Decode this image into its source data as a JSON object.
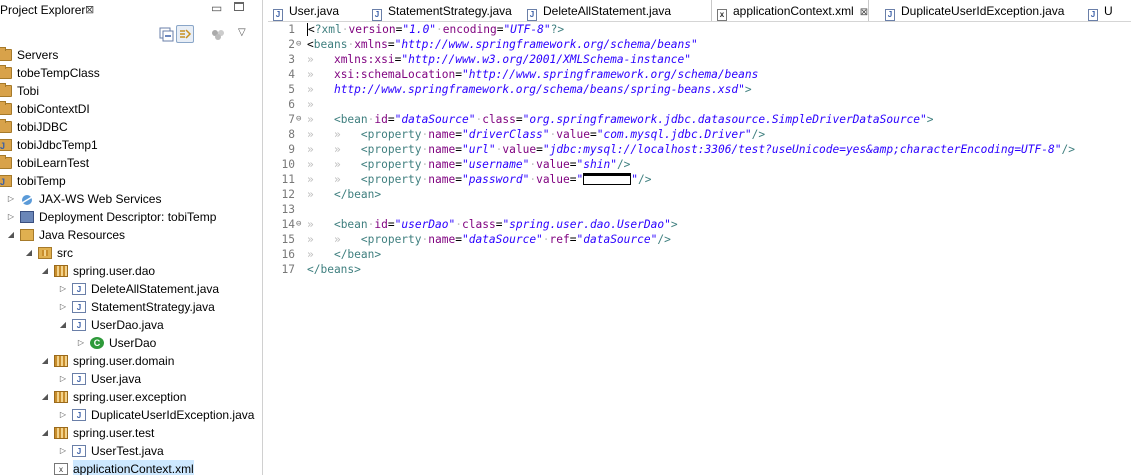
{
  "explorer": {
    "title": "Project Explorer",
    "close_glyph": "⊠",
    "min_glyph": "▭",
    "menu_glyph": "▽",
    "tree": [
      {
        "label": "Servers",
        "icon": "folder-icon",
        "depth": 0,
        "twisty": ""
      },
      {
        "label": "tobeTempClass",
        "icon": "folder-icon",
        "depth": 0,
        "twisty": ""
      },
      {
        "label": "Tobi",
        "icon": "folder-icon",
        "depth": 0,
        "twisty": ""
      },
      {
        "label": "tobiContextDI",
        "icon": "folder-icon",
        "depth": 0,
        "twisty": ""
      },
      {
        "label": "tobiJDBC",
        "icon": "folder-icon",
        "depth": 0,
        "twisty": ""
      },
      {
        "label": "tobiJdbcTemp1",
        "icon": "java-project-icon",
        "depth": 0,
        "twisty": ""
      },
      {
        "label": "tobiLearnTest",
        "icon": "folder-icon",
        "depth": 0,
        "twisty": ""
      },
      {
        "label": "tobiTemp",
        "icon": "java-project-icon",
        "depth": 0,
        "twisty": ""
      },
      {
        "label": "JAX-WS Web Services",
        "icon": "web-services-icon",
        "depth": 1,
        "twisty": "▷"
      },
      {
        "label": "Deployment Descriptor: tobiTemp",
        "icon": "deployment-descriptor-icon",
        "depth": 1,
        "twisty": "▷"
      },
      {
        "label": "Java Resources",
        "icon": "java-resources-icon",
        "depth": 1,
        "twisty": "◢"
      },
      {
        "label": "src",
        "icon": "source-folder-icon",
        "depth": 2,
        "twisty": "◢"
      },
      {
        "label": "spring.user.dao",
        "icon": "package-icon",
        "depth": 3,
        "twisty": "◢"
      },
      {
        "label": "DeleteAllStatement.java",
        "icon": "java-file-icon",
        "depth": 4,
        "twisty": "▷"
      },
      {
        "label": "StatementStrategy.java",
        "icon": "java-file-icon",
        "depth": 4,
        "twisty": "▷"
      },
      {
        "label": "UserDao.java",
        "icon": "java-file-icon",
        "depth": 4,
        "twisty": "◢"
      },
      {
        "label": "UserDao",
        "icon": "class-icon",
        "depth": 5,
        "twisty": "▷"
      },
      {
        "label": "spring.user.domain",
        "icon": "package-icon",
        "depth": 3,
        "twisty": "◢"
      },
      {
        "label": "User.java",
        "icon": "java-file-icon",
        "depth": 4,
        "twisty": "▷"
      },
      {
        "label": "spring.user.exception",
        "icon": "package-icon",
        "depth": 3,
        "twisty": "◢"
      },
      {
        "label": "DuplicateUserIdException.java",
        "icon": "java-file-icon",
        "depth": 4,
        "twisty": "▷"
      },
      {
        "label": "spring.user.test",
        "icon": "package-icon",
        "depth": 3,
        "twisty": "◢"
      },
      {
        "label": "UserTest.java",
        "icon": "java-file-icon",
        "depth": 4,
        "twisty": "▷"
      },
      {
        "label": "applicationContext.xml",
        "icon": "xml-file-icon",
        "depth": 3,
        "twisty": "",
        "selected": true
      }
    ]
  },
  "editor": {
    "tabs": [
      {
        "label": "User.java",
        "icon": "java-file-icon",
        "active": false
      },
      {
        "label": "StatementStrategy.java",
        "icon": "java-file-icon",
        "active": false
      },
      {
        "label": "DeleteAllStatement.java",
        "icon": "java-file-icon",
        "active": false
      },
      {
        "label": "applicationContext.xml",
        "icon": "xml-file-icon",
        "active": true,
        "close": "⊠"
      },
      {
        "label": "DuplicateUserIdException.java",
        "icon": "java-file-icon",
        "active": false
      },
      {
        "label": "U",
        "icon": "java-file-icon",
        "active": false
      }
    ],
    "lines": [
      {
        "n": "1",
        "fold": "",
        "segs": [
          [
            "p",
            "<"
          ],
          [
            "t",
            "?xml"
          ],
          [
            "ws",
            "·"
          ],
          [
            "a",
            "version"
          ],
          [
            "p",
            "="
          ],
          [
            "v",
            "\"1.0\""
          ],
          [
            "ws",
            "·"
          ],
          [
            "a",
            "encoding"
          ],
          [
            "p",
            "="
          ],
          [
            "v",
            "\"UTF-8\""
          ],
          [
            "t",
            "?>"
          ]
        ]
      },
      {
        "n": "2",
        "fold": "⊖",
        "segs": [
          [
            "p",
            "<"
          ],
          [
            "t",
            "beans"
          ],
          [
            "ws",
            "·"
          ],
          [
            "a",
            "xmlns"
          ],
          [
            "p",
            "="
          ],
          [
            "v",
            "\"http://www.springframework.org/schema/beans\""
          ]
        ]
      },
      {
        "n": "3",
        "fold": "",
        "segs": [
          [
            "ws",
            "»   "
          ],
          [
            "a",
            "xmlns:xsi"
          ],
          [
            "p",
            "="
          ],
          [
            "v",
            "\"http://www.w3.org/2001/XMLSchema-instance\""
          ]
        ]
      },
      {
        "n": "4",
        "fold": "",
        "segs": [
          [
            "ws",
            "»   "
          ],
          [
            "a",
            "xsi:schemaLocation"
          ],
          [
            "p",
            "="
          ],
          [
            "v",
            "\"http://www.springframework.org/schema/beans"
          ]
        ]
      },
      {
        "n": "5",
        "fold": "",
        "segs": [
          [
            "ws",
            "»   "
          ],
          [
            "v",
            "http://www.springframework.org/schema/beans/spring-beans.xsd\""
          ],
          [
            "t",
            ">"
          ]
        ]
      },
      {
        "n": "6",
        "fold": "",
        "segs": [
          [
            "ws",
            "»"
          ]
        ]
      },
      {
        "n": "7",
        "fold": "⊖",
        "segs": [
          [
            "ws",
            "»   "
          ],
          [
            "t",
            "<bean"
          ],
          [
            "ws",
            "·"
          ],
          [
            "a",
            "id"
          ],
          [
            "p",
            "="
          ],
          [
            "v",
            "\"dataSource\""
          ],
          [
            "ws",
            "·"
          ],
          [
            "a",
            "class"
          ],
          [
            "p",
            "="
          ],
          [
            "v",
            "\"org.springframework.jdbc.datasource.SimpleDriverDataSource\""
          ],
          [
            "t",
            ">"
          ]
        ]
      },
      {
        "n": "8",
        "fold": "",
        "segs": [
          [
            "ws",
            "»   »   "
          ],
          [
            "t",
            "<property"
          ],
          [
            "ws",
            "·"
          ],
          [
            "a",
            "name"
          ],
          [
            "p",
            "="
          ],
          [
            "v",
            "\"driverClass\""
          ],
          [
            "ws",
            "·"
          ],
          [
            "a",
            "value"
          ],
          [
            "p",
            "="
          ],
          [
            "v",
            "\"com.mysql.jdbc.Driver\""
          ],
          [
            "t",
            "/>"
          ]
        ]
      },
      {
        "n": "9",
        "fold": "",
        "segs": [
          [
            "ws",
            "»   »   "
          ],
          [
            "t",
            "<property"
          ],
          [
            "ws",
            "·"
          ],
          [
            "a",
            "name"
          ],
          [
            "p",
            "="
          ],
          [
            "v",
            "\"url\""
          ],
          [
            "ws",
            "·"
          ],
          [
            "a",
            "value"
          ],
          [
            "p",
            "="
          ],
          [
            "v",
            "\"jdbc:mysql://localhost:3306/test?useUnicode=yes&amp;characterEncoding=UTF-8\""
          ],
          [
            "t",
            "/>"
          ]
        ]
      },
      {
        "n": "10",
        "fold": "",
        "segs": [
          [
            "ws",
            "»   »   "
          ],
          [
            "t",
            "<property"
          ],
          [
            "ws",
            "·"
          ],
          [
            "a",
            "name"
          ],
          [
            "p",
            "="
          ],
          [
            "v",
            "\"username\""
          ],
          [
            "ws",
            "·"
          ],
          [
            "a",
            "value"
          ],
          [
            "p",
            "="
          ],
          [
            "v",
            "\"shin\""
          ],
          [
            "t",
            "/>"
          ]
        ]
      },
      {
        "n": "11",
        "fold": "",
        "segs": [
          [
            "ws",
            "»   »   "
          ],
          [
            "t",
            "<property"
          ],
          [
            "ws",
            "·"
          ],
          [
            "a",
            "name"
          ],
          [
            "p",
            "="
          ],
          [
            "v",
            "\"password\""
          ],
          [
            "ws",
            "·"
          ],
          [
            "a",
            "value"
          ],
          [
            "p",
            "="
          ],
          [
            "v",
            "\""
          ],
          [
            "mask",
            ""
          ],
          [
            "v",
            "\""
          ],
          [
            "t",
            "/>"
          ]
        ]
      },
      {
        "n": "12",
        "fold": "",
        "segs": [
          [
            "ws",
            "»   "
          ],
          [
            "t",
            "</bean>"
          ]
        ]
      },
      {
        "n": "13",
        "fold": "",
        "segs": []
      },
      {
        "n": "14",
        "fold": "⊖",
        "segs": [
          [
            "ws",
            "»   "
          ],
          [
            "t",
            "<bean"
          ],
          [
            "ws",
            "·"
          ],
          [
            "a",
            "id"
          ],
          [
            "p",
            "="
          ],
          [
            "v",
            "\"userDao\""
          ],
          [
            "ws",
            "·"
          ],
          [
            "a",
            "class"
          ],
          [
            "p",
            "="
          ],
          [
            "v",
            "\"spring.user.dao.UserDao\""
          ],
          [
            "t",
            ">"
          ]
        ]
      },
      {
        "n": "15",
        "fold": "",
        "segs": [
          [
            "ws",
            "»   »   "
          ],
          [
            "t",
            "<property"
          ],
          [
            "ws",
            "·"
          ],
          [
            "a",
            "name"
          ],
          [
            "p",
            "="
          ],
          [
            "v",
            "\"dataSource\""
          ],
          [
            "ws",
            "·"
          ],
          [
            "a",
            "ref"
          ],
          [
            "p",
            "="
          ],
          [
            "v",
            "\"dataSource\""
          ],
          [
            "t",
            "/>"
          ]
        ]
      },
      {
        "n": "16",
        "fold": "",
        "segs": [
          [
            "ws",
            "»   "
          ],
          [
            "t",
            "</bean>"
          ]
        ]
      },
      {
        "n": "17",
        "fold": "",
        "segs": [
          [
            "t",
            "</beans>"
          ]
        ]
      }
    ]
  },
  "colors": {
    "tag": "#3f7f7f",
    "attribute": "#7f007f",
    "value": "#2a00ff",
    "selection": "#cde8ff"
  }
}
